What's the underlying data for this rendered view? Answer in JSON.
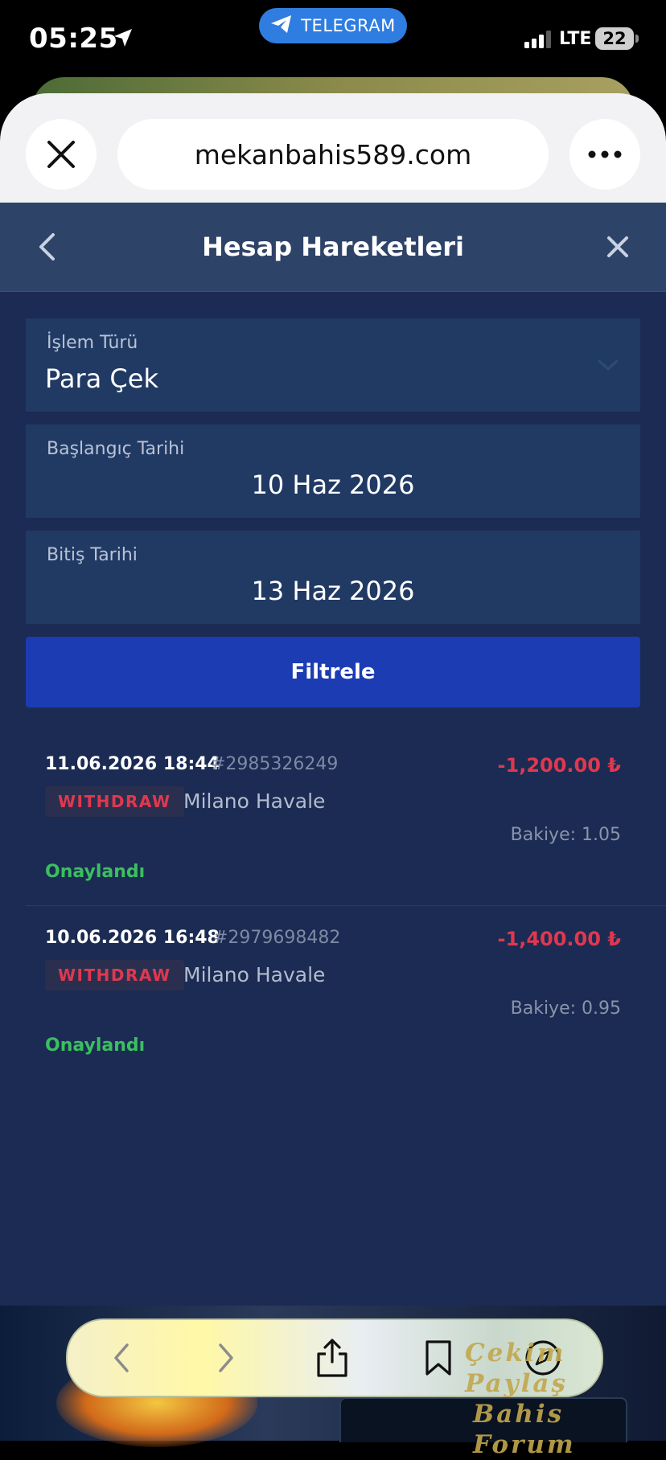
{
  "status_bar": {
    "time": "05:25",
    "carrier_pill": "TELEGRAM",
    "network": "LTE",
    "battery": "22"
  },
  "browser": {
    "url": "mekanbahis589.com"
  },
  "header": {
    "title": "Hesap Hareketleri"
  },
  "filters": {
    "type_label": "İşlem Türü",
    "type_value": "Para Çek",
    "start_label": "Başlangıç Tarihi",
    "start_value": "10 Haz 2026",
    "end_label": "Bitiş Tarihi",
    "end_value": "13 Haz 2026",
    "filter_button": "Filtrele"
  },
  "transactions": [
    {
      "datetime": "11.06.2026 18:44",
      "id": "#2985326249",
      "amount": "-1,200.00 ₺",
      "type": "WITHDRAW",
      "method": "Milano Havale",
      "balance": "Bakiye: 1.05",
      "status": "Onaylandı"
    },
    {
      "datetime": "10.06.2026 16:48",
      "id": "#2979698482",
      "amount": "-1,400.00 ₺",
      "type": "WITHDRAW",
      "method": "Milano Havale",
      "balance": "Bakiye: 0.95",
      "status": "Onaylandı"
    }
  ],
  "watermark": {
    "line1": "Çekim Paylaş",
    "line2": "Bahis Forum"
  },
  "colors": {
    "page_bg": "#1b2b53",
    "header_bg": "#2e4368",
    "field_bg": "#213a64",
    "button_bg": "#1c3cb4",
    "negative": "#e0384f",
    "success": "#3bbf5f"
  }
}
